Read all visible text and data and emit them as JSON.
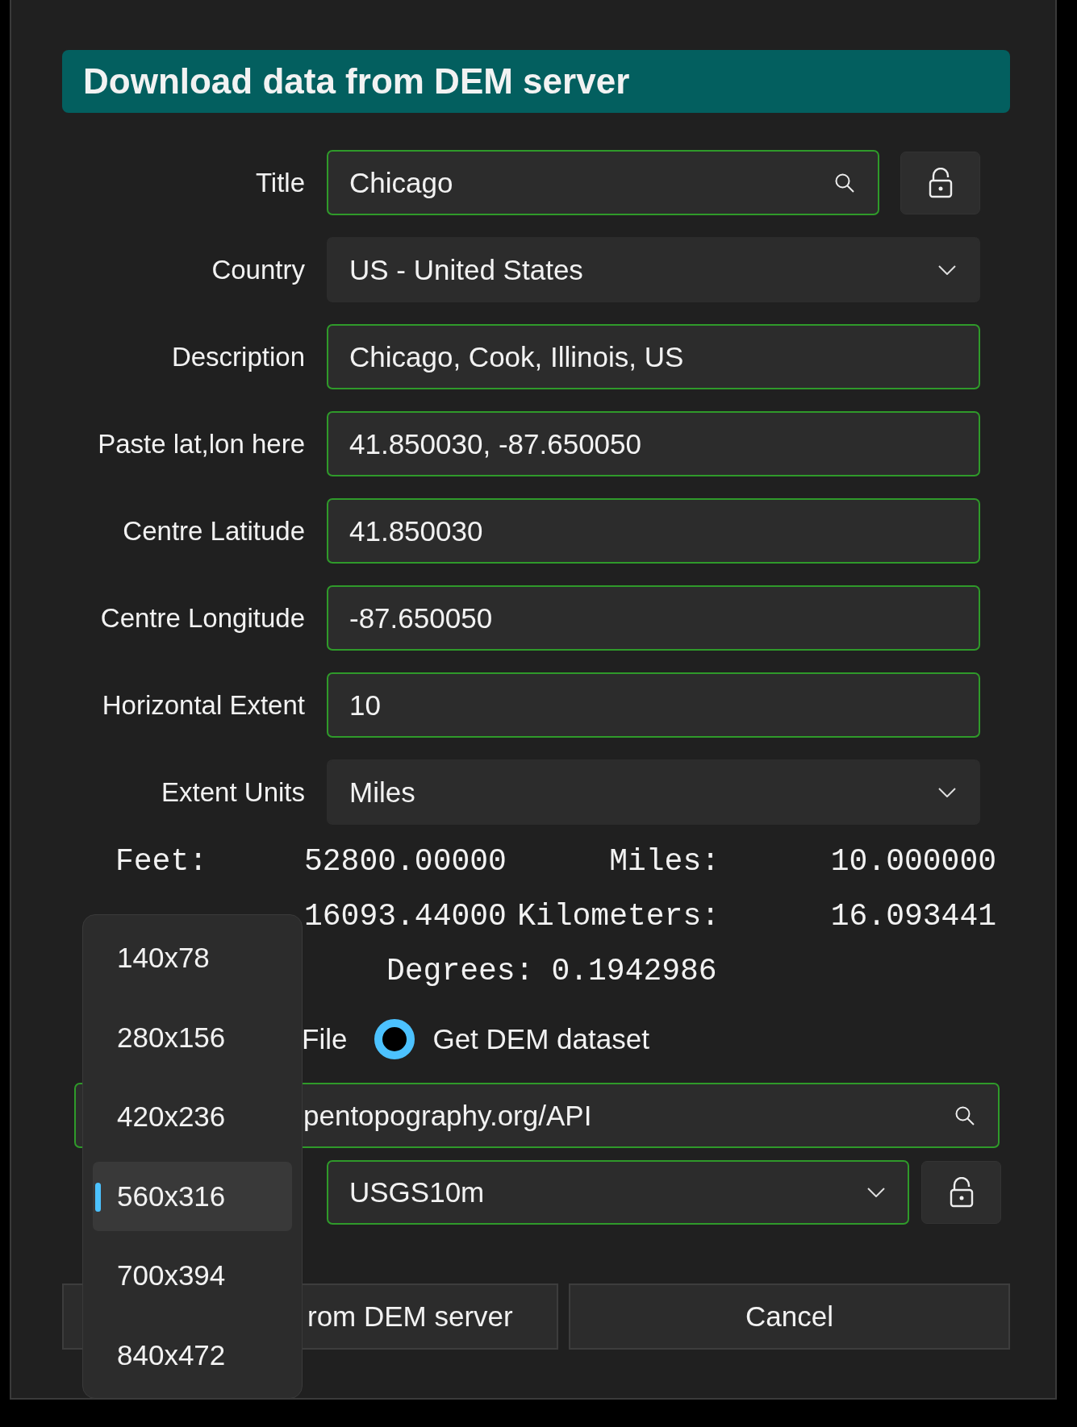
{
  "dialog": {
    "title": "Download data from DEM server"
  },
  "fields": [
    {
      "label": "Title",
      "value": "Chicago",
      "kind": "search",
      "lock": true
    },
    {
      "label": "Country",
      "value": "US - United States",
      "kind": "dropdown"
    },
    {
      "label": "Description",
      "value": "Chicago, Cook, Illinois, US",
      "kind": "text"
    },
    {
      "label": "Paste lat,lon here",
      "value": "41.850030, -87.650050",
      "kind": "text"
    },
    {
      "label": "Centre Latitude",
      "value": "41.850030",
      "kind": "text"
    },
    {
      "label": "Centre Longitude",
      "value": "-87.650050",
      "kind": "text"
    },
    {
      "label": "Horizontal Extent",
      "value": "10",
      "kind": "text"
    },
    {
      "label": "Extent Units",
      "value": "Miles",
      "kind": "dropdown"
    }
  ],
  "conversions": [
    {
      "label": "Feet:",
      "value": "52800.00000",
      "label_2": "Miles:",
      "value_2": "10.000000"
    },
    {
      "value": "16093.44000",
      "label_2": "Kilometers:",
      "value_2": "16.093441"
    }
  ],
  "degrees": {
    "label": "Degrees:",
    "value": "0.1942986"
  },
  "source_options": [
    {
      "kind": "partial",
      "label": "File"
    },
    {
      "kind": "radio",
      "label": "Get DEM dataset",
      "selected": true
    }
  ],
  "server_url": "pentopography.org/API",
  "dataset": "USGS10m",
  "buttons": [
    {
      "label": "rom DEM server",
      "kind": "partial"
    },
    {
      "label": "Cancel",
      "kind": "full"
    }
  ],
  "size_menu": [
    {
      "label": "140x78",
      "selected": false
    },
    {
      "label": "280x156",
      "selected": false
    },
    {
      "label": "420x236",
      "selected": false
    },
    {
      "label": "560x316",
      "selected": true
    },
    {
      "label": "700x394",
      "selected": false
    },
    {
      "label": "840x472",
      "selected": false
    }
  ]
}
